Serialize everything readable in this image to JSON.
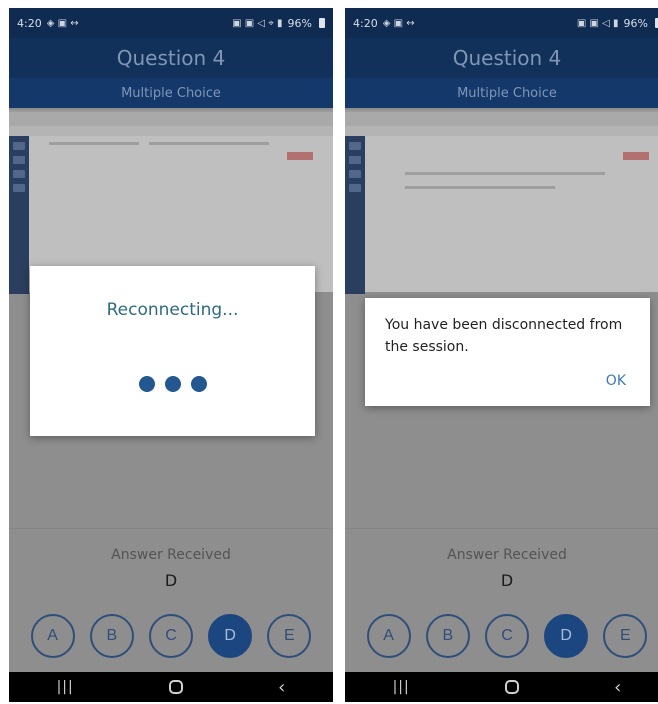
{
  "status_bar": {
    "time": "4:20",
    "battery_left": "96%",
    "battery_right": "96%"
  },
  "header": {
    "title": "Question 4",
    "subtitle": "Multiple Choice"
  },
  "answer": {
    "label": "Answer Received",
    "value": "D"
  },
  "choices": [
    "A",
    "B",
    "C",
    "D",
    "E"
  ],
  "selected_choice": "D",
  "reconnect_dialog": {
    "message": "Reconnecting..."
  },
  "disconnect_dialog": {
    "message": "You have been disconnected from the session.",
    "ok_label": "OK"
  },
  "nav": {
    "recents_icon": "|||",
    "back_icon": "‹"
  },
  "colors": {
    "header": "#11305a",
    "accent": "#1c467f",
    "reconnect_text": "#2e6b82",
    "ok_text": "#3a7ab0"
  }
}
